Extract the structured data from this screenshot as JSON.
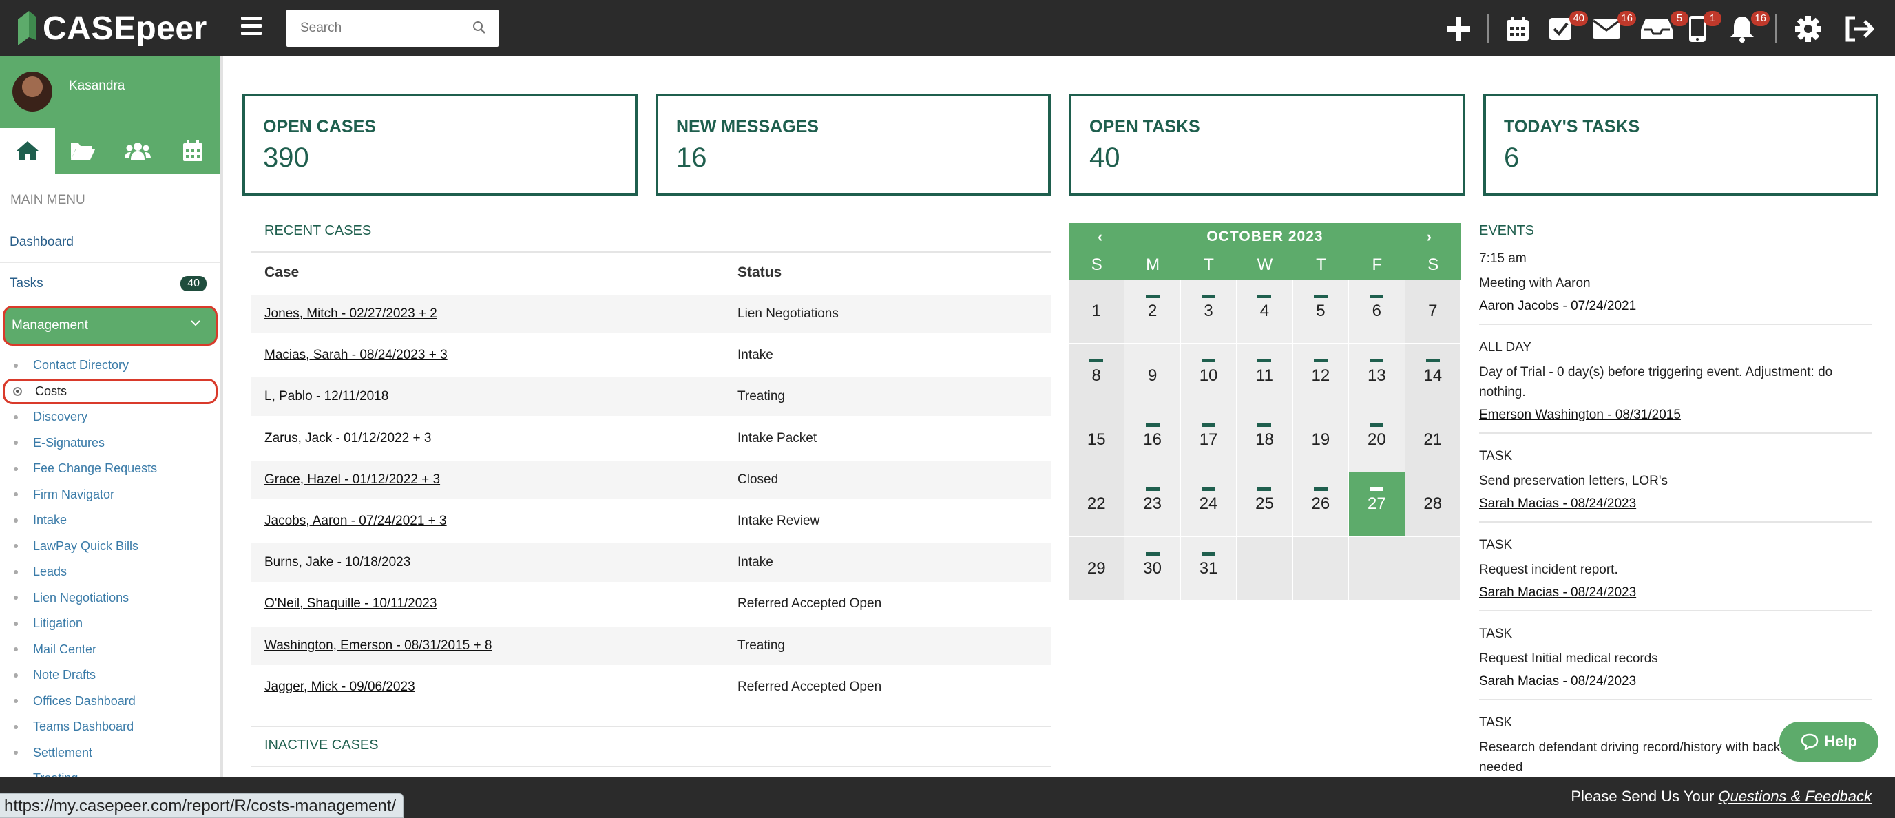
{
  "app": {
    "logo_text": "CASEpeer",
    "brand_color": "#5dab6b",
    "dark_green": "#1f5f4e"
  },
  "header": {
    "search_placeholder": "Search",
    "badges": {
      "tasks": "40",
      "messages": "16",
      "inbox": "5",
      "phone": "1",
      "notifications": "16"
    }
  },
  "sidebar": {
    "user_name": "Kasandra",
    "main_menu_label": "MAIN MENU",
    "dashboard": "Dashboard",
    "tasks": "Tasks",
    "tasks_count": "40",
    "management": "Management",
    "sub_items": [
      "Contact Directory",
      "Costs",
      "Discovery",
      "E-Signatures",
      "Fee Change Requests",
      "Firm Navigator",
      "Intake",
      "LawPay Quick Bills",
      "Leads",
      "Lien Negotiations",
      "Litigation",
      "Mail Center",
      "Note Drafts",
      "Offices Dashboard",
      "Teams Dashboard",
      "Settlement",
      "Treating"
    ]
  },
  "cards": [
    {
      "label": "OPEN CASES",
      "value": "390"
    },
    {
      "label": "NEW MESSAGES",
      "value": "16"
    },
    {
      "label": "OPEN TASKS",
      "value": "40"
    },
    {
      "label": "TODAY'S TASKS",
      "value": "6"
    }
  ],
  "recent_cases": {
    "title": "RECENT CASES",
    "col_case": "Case",
    "col_status": "Status",
    "rows": [
      {
        "case": "Jones, Mitch - 02/27/2023 + 2",
        "status": "Lien Negotiations"
      },
      {
        "case": "Macias, Sarah - 08/24/2023 + 3",
        "status": "Intake"
      },
      {
        "case": "L, Pablo - 12/11/2018",
        "status": "Treating"
      },
      {
        "case": "Zarus, Jack - 01/12/2022 + 3",
        "status": "Intake Packet"
      },
      {
        "case": "Grace, Hazel - 01/12/2022 + 3",
        "status": "Closed"
      },
      {
        "case": "Jacobs, Aaron - 07/24/2021 + 3",
        "status": "Intake Review"
      },
      {
        "case": "Burns, Jake - 10/18/2023",
        "status": "Intake"
      },
      {
        "case": "O'Neil, Shaquille - 10/11/2023",
        "status": "Referred Accepted Open"
      },
      {
        "case": "Washington, Emerson - 08/31/2015 + 8",
        "status": "Treating"
      },
      {
        "case": "Jagger, Mick - 09/06/2023",
        "status": "Referred Accepted Open"
      }
    ]
  },
  "inactive_cases": {
    "title": "INACTIVE CASES"
  },
  "calendar": {
    "month": "OCTOBER 2023",
    "prev": "‹",
    "next": "›",
    "dow": [
      "S",
      "M",
      "T",
      "W",
      "T",
      "F",
      "S"
    ],
    "days": [
      "1",
      "2",
      "3",
      "4",
      "5",
      "6",
      "7",
      "8",
      "9",
      "10",
      "11",
      "12",
      "13",
      "14",
      "15",
      "16",
      "17",
      "18",
      "19",
      "20",
      "21",
      "22",
      "23",
      "24",
      "25",
      "26",
      "27",
      "28",
      "29",
      "30",
      "31",
      "",
      "",
      "",
      ""
    ],
    "event_days": [
      "2",
      "3",
      "4",
      "5",
      "6",
      "8",
      "10",
      "11",
      "12",
      "13",
      "14",
      "16",
      "17",
      "18",
      "20",
      "23",
      "24",
      "25",
      "26",
      "27",
      "30",
      "31"
    ],
    "today": "27"
  },
  "events": {
    "title": "EVENTS",
    "items": [
      {
        "time": "7:15 am",
        "desc": "Meeting with Aaron",
        "link": "Aaron Jacobs - 07/24/2021"
      },
      {
        "time": "ALL DAY",
        "desc": "Day of Trial - 0 day(s) before triggering event. Adjustment: do nothing.",
        "link": "Emerson Washington - 08/31/2015"
      },
      {
        "time": "TASK",
        "desc": "Send preservation letters, LOR's",
        "link": "Sarah Macias - 08/24/2023"
      },
      {
        "time": "TASK",
        "desc": "Request incident report.",
        "link": "Sarah Macias - 08/24/2023"
      },
      {
        "time": "TASK",
        "desc": "Request Initial medical records",
        "link": "Sarah Macias - 08/24/2023"
      },
      {
        "time": "TASK",
        "desc": "Research defendant driving record/history with background check if needed",
        "link": ""
      }
    ]
  },
  "help_label": "Help",
  "footer": {
    "prefix": "Please Send Us Your ",
    "link": "Questions & Feedback"
  },
  "status_url": "https://my.casepeer.com/report/R/costs-management/"
}
